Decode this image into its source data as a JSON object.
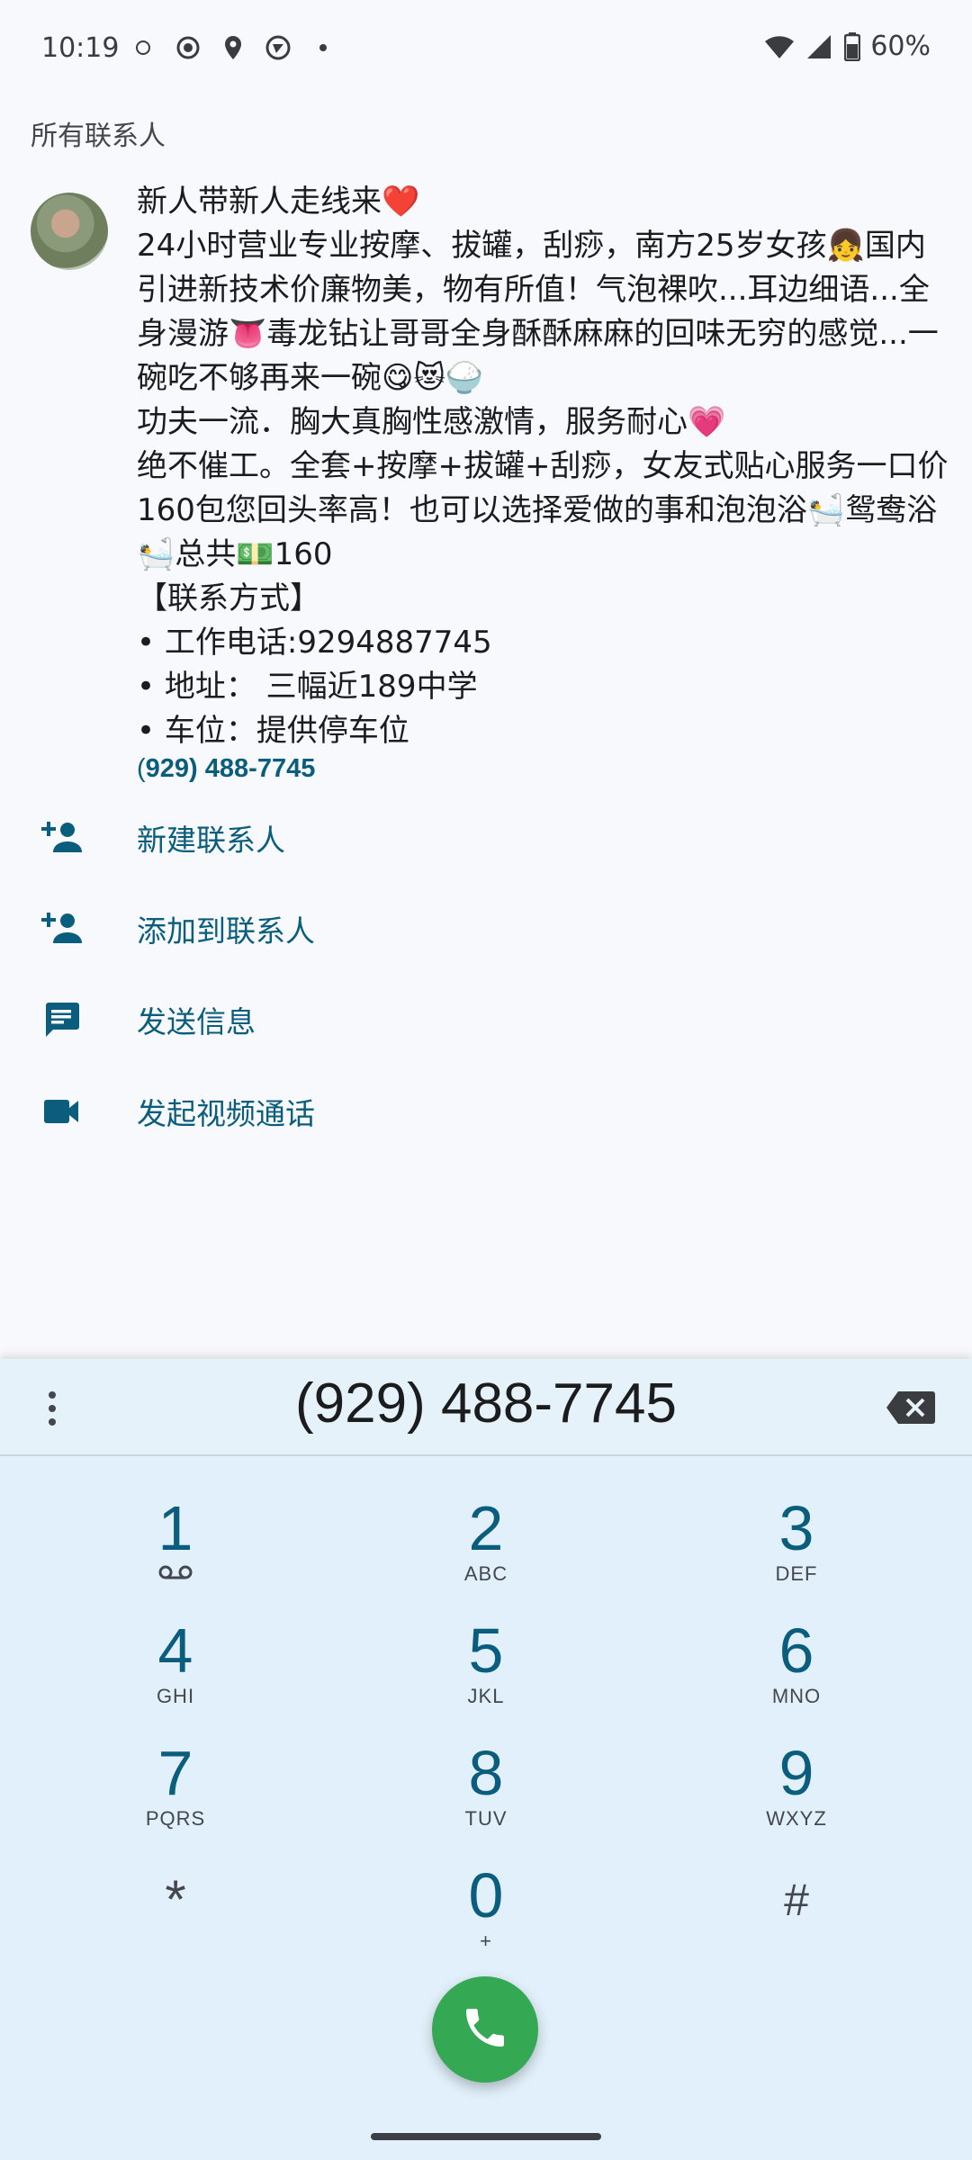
{
  "status_bar": {
    "time": "10:19",
    "battery": "60%"
  },
  "list_heading": "所有联系人",
  "contact": {
    "name_text": "新人带新人走线来❤️\n24小时营业专业按摩、拔罐，刮痧，南方25岁女孩👧国内引进新技术价廉物美，物有所值！气泡裸吹...耳边细语...全身漫游👅毒龙钻让哥哥全身酥酥麻麻的回味无穷的感觉...一碗吃不够再来一碗😋😻🍚\n功夫一流．胸大真胸性感激情，服务耐心💗\n绝不催工。全套+按摩+拔罐+刮痧，女友式贴心服务一口价160包您回头率高！也可以选择爱做的事和泡泡浴🛀鸳鸯浴🛀总共💵160\n【联系方式】\n• 工作电话:9294887745\n• 地址： 三幅近189中学\n• 车位：提供停车位",
    "number_prefix": "(",
    "number": "929) 488-7745"
  },
  "actions": [
    {
      "label": "新建联系人",
      "icon": "person-add-icon"
    },
    {
      "label": "添加到联系人",
      "icon": "person-add-icon"
    },
    {
      "label": "发送信息",
      "icon": "message-icon"
    },
    {
      "label": "发起视频通话",
      "icon": "videocam-icon"
    }
  ],
  "dialer": {
    "digits": "(929) 488-7745",
    "keys": [
      {
        "num": "1",
        "letters": ""
      },
      {
        "num": "2",
        "letters": "ABC"
      },
      {
        "num": "3",
        "letters": "DEF"
      },
      {
        "num": "4",
        "letters": "GHI"
      },
      {
        "num": "5",
        "letters": "JKL"
      },
      {
        "num": "6",
        "letters": "MNO"
      },
      {
        "num": "7",
        "letters": "PQRS"
      },
      {
        "num": "8",
        "letters": "TUV"
      },
      {
        "num": "9",
        "letters": "WXYZ"
      },
      {
        "num": "*",
        "letters": ""
      },
      {
        "num": "0",
        "letters": "+"
      },
      {
        "num": "#",
        "letters": ""
      }
    ]
  },
  "colors": {
    "accent": "#0b5d7e",
    "call_green": "#34a853",
    "dialer_bg": "#e1f0fa"
  }
}
